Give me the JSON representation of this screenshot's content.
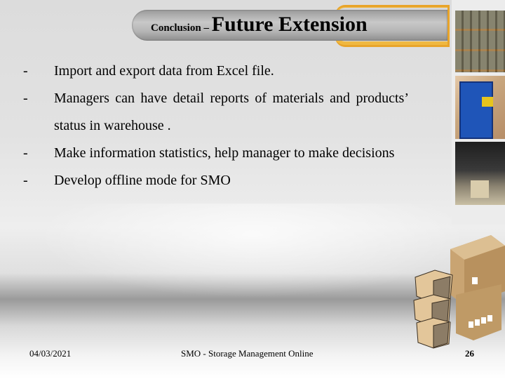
{
  "title": {
    "prefix": "Conclusion – ",
    "main": "Future Extension"
  },
  "bullets": [
    {
      "dash": "-",
      "text": "Import and export data from Excel file."
    },
    {
      "dash": "-",
      "text": "Managers can have detail reports of materials and products’ status in warehouse ."
    },
    {
      "dash": "-",
      "text": "Make information statistics, help manager to make decisions"
    },
    {
      "dash": "-",
      "text": "Develop offline mode for SMO"
    }
  ],
  "images": {
    "photo1": "warehouse-shelves-photo",
    "photo2": "blue-pallet-racks-photo",
    "photo3": "warehouse-interior-photo",
    "illustration": "cardboard-boxes-illustration"
  },
  "footer": {
    "date": "04/03/2021",
    "center": "SMO - Storage Management Online",
    "page": "26"
  },
  "colors": {
    "accent": "#e8a42a",
    "title_bar": "#b5b5b5"
  }
}
